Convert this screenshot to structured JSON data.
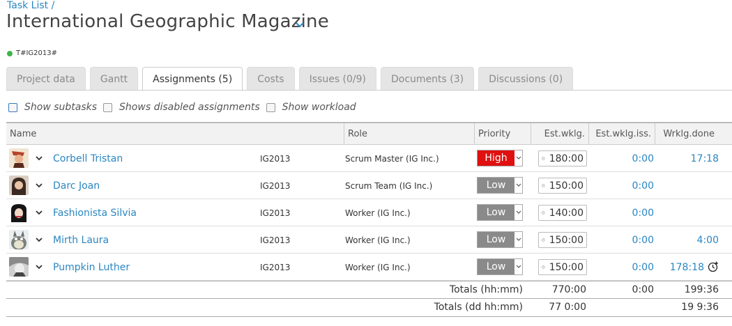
{
  "breadcrumb": "Task List /",
  "title": "International Geographic Magazine",
  "project_code": "T#IG2013#",
  "status_color": "#3cb54a",
  "tabs": [
    {
      "label": "Project data"
    },
    {
      "label": "Gantt"
    },
    {
      "label": "Assignments (5)"
    },
    {
      "label": "Costs"
    },
    {
      "label": "Issues (0/9)"
    },
    {
      "label": "Documents (3)"
    },
    {
      "label": "Discussions (0)"
    }
  ],
  "options": {
    "show_subtasks": "Show subtasks",
    "show_disabled": "Shows disabled assignments",
    "show_workload": "Show workload"
  },
  "columns": {
    "name": "Name",
    "role": "Role",
    "priority": "Priority",
    "est": "Est.wklg.",
    "est_iss": "Est.wklg.iss.",
    "done": "Wrklg.done"
  },
  "rows": [
    {
      "name": "Corbell Tristan",
      "code": "IG2013",
      "role": "Scrum Master (IG Inc.)",
      "priority": "High",
      "est": "180:00",
      "est_iss": "0:00",
      "done": "17:18"
    },
    {
      "name": "Darc Joan",
      "code": "IG2013",
      "role": "Scrum Team (IG Inc.)",
      "priority": "Low",
      "est": "150:00",
      "est_iss": "0:00",
      "done": ""
    },
    {
      "name": "Fashionista Silvia",
      "code": "IG2013",
      "role": "Worker (IG Inc.)",
      "priority": "Low",
      "est": "140:00",
      "est_iss": "0:00",
      "done": ""
    },
    {
      "name": "Mirth Laura",
      "code": "IG2013",
      "role": "Worker (IG Inc.)",
      "priority": "Low",
      "est": "150:00",
      "est_iss": "0:00",
      "done": "4:00"
    },
    {
      "name": "Pumpkin Luther",
      "code": "IG2013",
      "role": "Worker (IG Inc.)",
      "priority": "Low",
      "est": "150:00",
      "est_iss": "0:00",
      "done": "178:18"
    }
  ],
  "totals_hhmm": {
    "label": "Totals (hh:mm)",
    "est": "770:00",
    "est_iss": "0:00",
    "done": "199:36"
  },
  "totals_ddhhmm": {
    "label": "Totals (dd hh:mm)",
    "est": "77 0:00",
    "est_iss": "",
    "done": "19 9:36"
  }
}
